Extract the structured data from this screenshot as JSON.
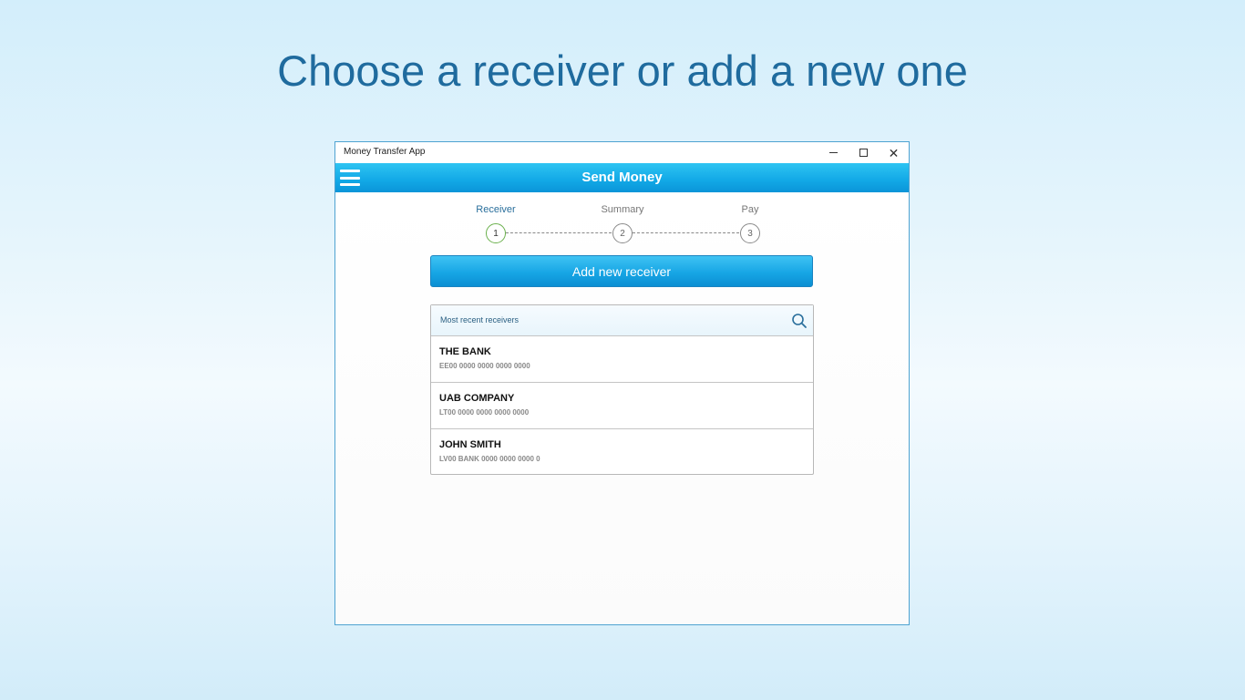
{
  "headline": "Choose a receiver or add a new one",
  "window": {
    "title": "Money Transfer App",
    "controls": {
      "minimize_icon": "minimize-icon",
      "maximize_icon": "maximize-icon",
      "close_icon": "close-icon",
      "close_glyph": "✕"
    }
  },
  "appbar": {
    "menu_icon": "hamburger-menu-icon",
    "title": "Send Money",
    "color": "#17a6e5"
  },
  "stepper": {
    "steps": [
      {
        "label": "Receiver",
        "number": "1",
        "state": "active"
      },
      {
        "label": "Summary",
        "number": "2",
        "state": "inactive"
      },
      {
        "label": "Pay",
        "number": "3",
        "state": "inactive"
      }
    ],
    "active_color": "#6ab04c"
  },
  "add_receiver": {
    "label": "Add new receiver"
  },
  "recent": {
    "header_label": "Most recent receivers",
    "search_icon": "search-icon",
    "receivers": [
      {
        "name": "THE BANK",
        "iban": "EE00 0000 0000 0000 0000"
      },
      {
        "name": "UAB COMPANY",
        "iban": "LT00 0000 0000 0000 0000"
      },
      {
        "name": "JOHN SMITH",
        "iban": "LV00 BANK 0000 0000 0000 0"
      }
    ]
  }
}
